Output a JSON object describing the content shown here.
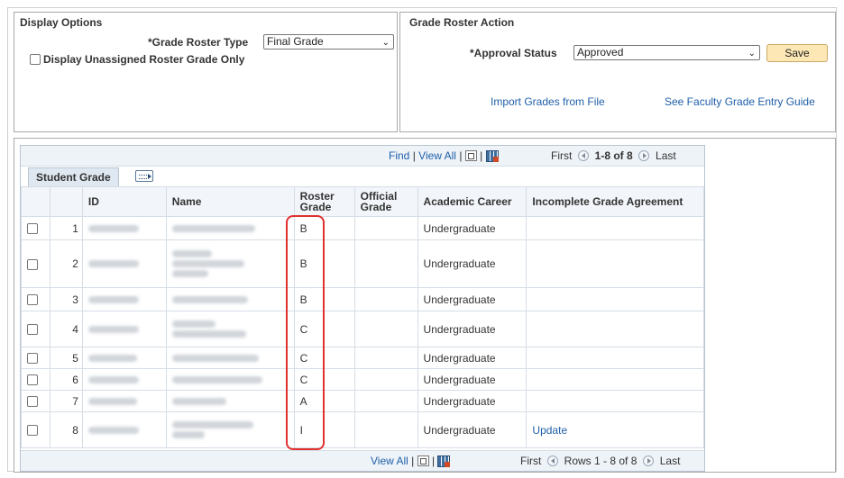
{
  "display_options": {
    "title": "Display Options",
    "roster_type_label": "*Grade Roster Type",
    "roster_type_value": "Final Grade",
    "unassigned_label": "Display Unassigned Roster Grade Only"
  },
  "roster_action": {
    "title": "Grade Roster Action",
    "approval_label": "*Approval Status",
    "approval_value": "Approved",
    "save_label": "Save",
    "import_link": "Import Grades from File",
    "guide_link": "See Faculty Grade Entry Guide"
  },
  "grid": {
    "tab_label": "Student Grade",
    "top_nav": {
      "find": "Find",
      "sep1": "|",
      "view_all": "View All",
      "sep2": "|",
      "first": "First",
      "range": "1-8 of 8",
      "last": "Last"
    },
    "bottom_nav": {
      "view_all": "View All",
      "sep": "|",
      "first": "First",
      "range": "Rows 1 - 8 of 8",
      "last": "Last"
    },
    "headers": {
      "id": "ID",
      "name": "Name",
      "roster_grade": "Roster Grade",
      "official_grade": "Official Grade",
      "academic_career": "Academic Career",
      "incomplete": "Incomplete Grade Agreement"
    },
    "rows": [
      {
        "num": "1",
        "grade": "B",
        "official": "",
        "career": "Undergraduate",
        "incomplete": ""
      },
      {
        "num": "2",
        "grade": "B",
        "official": "",
        "career": "Undergraduate",
        "incomplete": ""
      },
      {
        "num": "3",
        "grade": "B",
        "official": "",
        "career": "Undergraduate",
        "incomplete": ""
      },
      {
        "num": "4",
        "grade": "C",
        "official": "",
        "career": "Undergraduate",
        "incomplete": ""
      },
      {
        "num": "5",
        "grade": "C",
        "official": "",
        "career": "Undergraduate",
        "incomplete": ""
      },
      {
        "num": "6",
        "grade": "C",
        "official": "",
        "career": "Undergraduate",
        "incomplete": ""
      },
      {
        "num": "7",
        "grade": "A",
        "official": "",
        "career": "Undergraduate",
        "incomplete": ""
      },
      {
        "num": "8",
        "grade": "I",
        "official": "",
        "career": "Undergraduate",
        "incomplete": "Update"
      }
    ]
  },
  "colors": {
    "link": "#1f5fa8",
    "save_button": "#fde7b4",
    "highlight": "#e0312f"
  }
}
